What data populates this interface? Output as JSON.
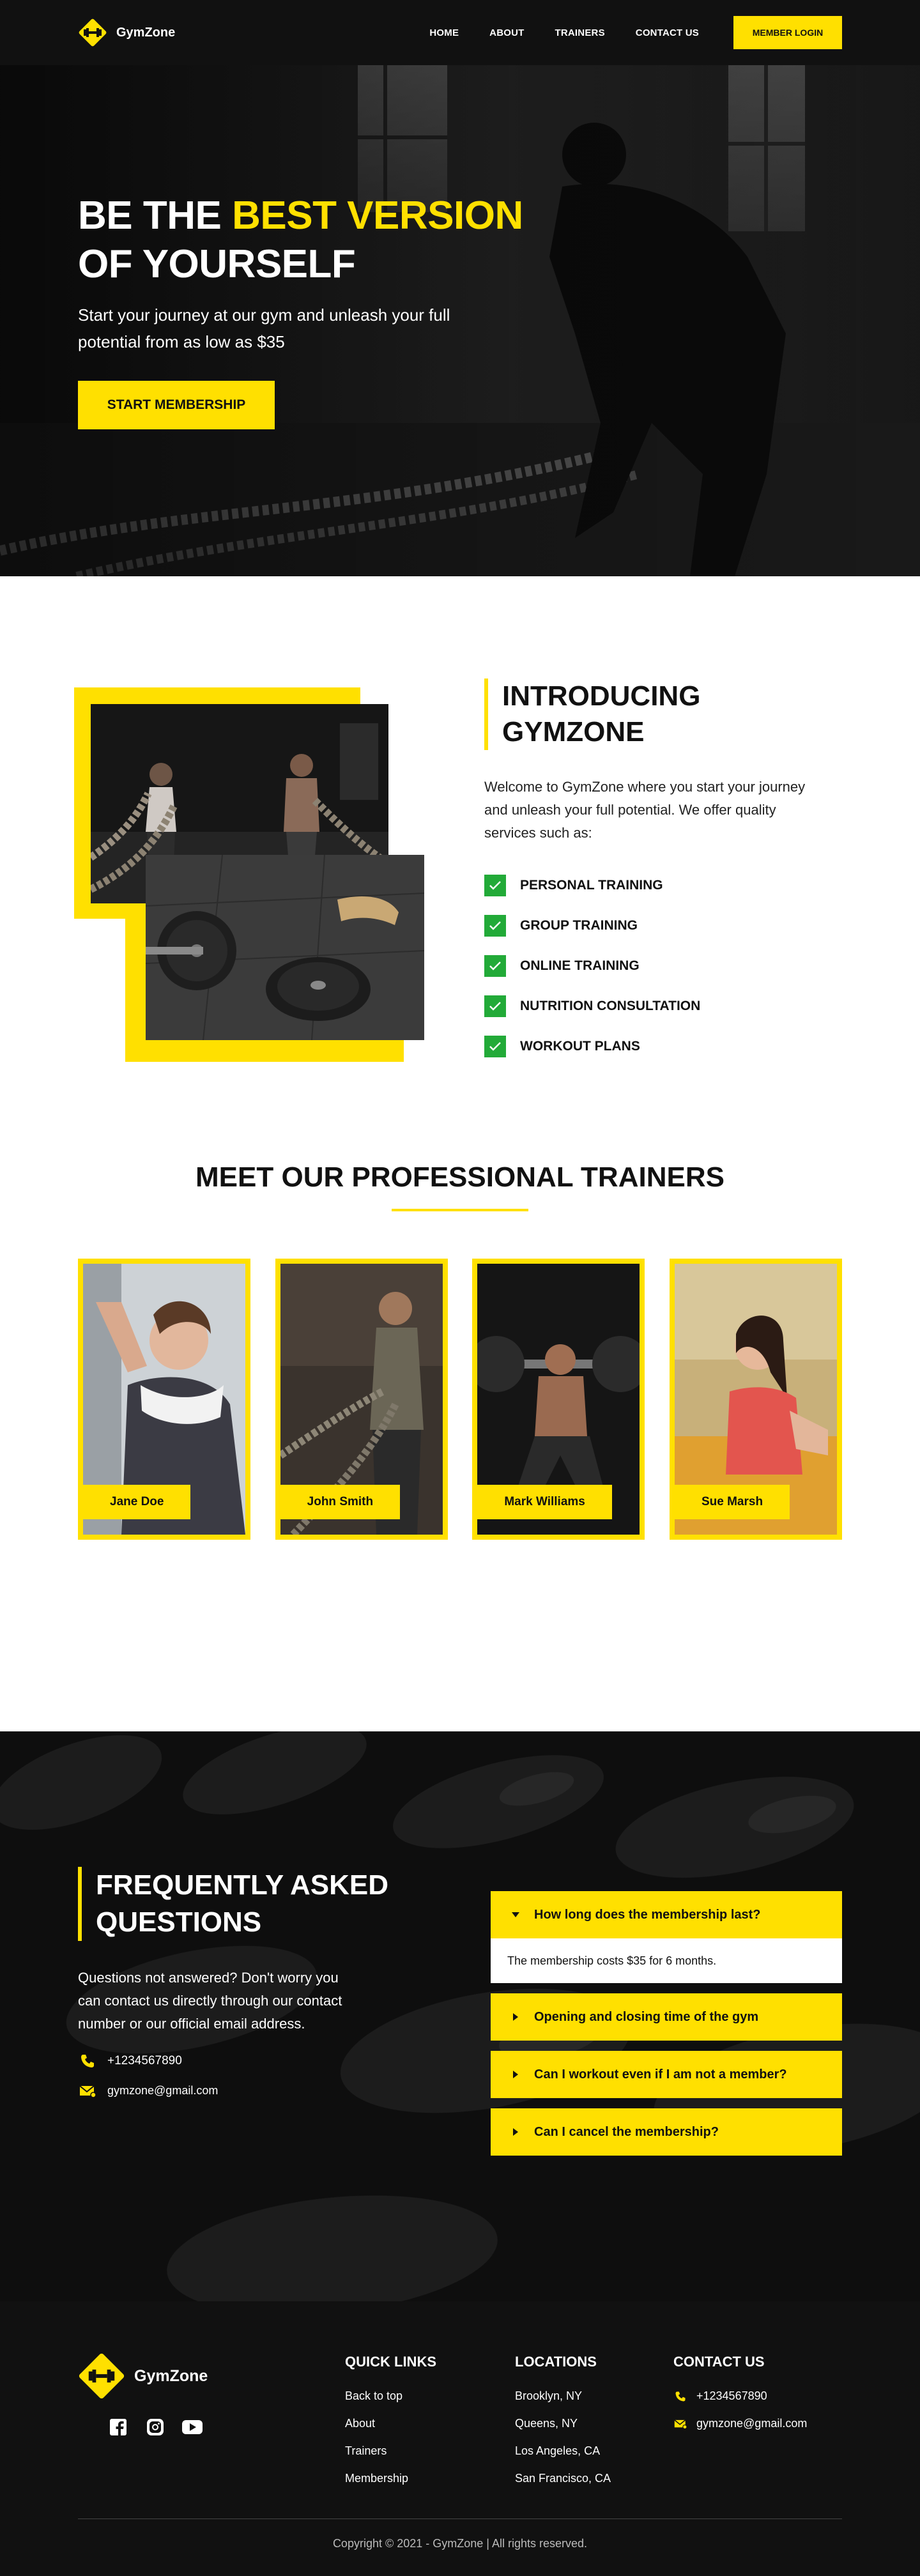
{
  "brand": {
    "name": "GymZone"
  },
  "header": {
    "nav": [
      "HOME",
      "ABOUT",
      "TRAINERS",
      "CONTACT US"
    ],
    "login_label": "MEMBER LOGIN"
  },
  "hero": {
    "title_lead": "BE THE",
    "title_accent": "BEST VERSION",
    "title_line2": "OF YOURSELF",
    "subtitle": "Start your journey at our gym and unleash your full potential from as low as $35",
    "cta_label": "START MEMBERSHIP"
  },
  "intro": {
    "heading": "INTRODUCING GYMZONE",
    "description": "Welcome to GymZone where you start your journey and unleash your full potential. We offer quality services such as:",
    "services": [
      "PERSONAL TRAINING",
      "GROUP TRAINING",
      "ONLINE TRAINING",
      "NUTRITION CONSULTATION",
      "WORKOUT PLANS"
    ]
  },
  "trainers": {
    "heading": "MEET OUR PROFESSIONAL TRAINERS",
    "list": [
      "Jane Doe",
      "John Smith",
      "Mark Williams",
      "Sue Marsh"
    ]
  },
  "faq": {
    "heading": "FREQUENTLY ASKED QUESTIONS",
    "description": "Questions not answered? Don't worry you can contact us directly through our contact number or our official email address.",
    "phone": "+1234567890",
    "email": "gymzone@gmail.com",
    "items": [
      {
        "question": "How long does the membership last?",
        "answer": "The membership costs $35 for 6 months.",
        "open": true
      },
      {
        "question": "Opening and closing time of the gym",
        "open": false
      },
      {
        "question": "Can I workout even if I am not a member?",
        "open": false
      },
      {
        "question": "Can I cancel the membership?",
        "open": false
      }
    ]
  },
  "footer": {
    "brand_name": "GymZone",
    "quick_links_title": "QUICK LINKS",
    "quick_links": [
      "Back to top",
      "About",
      "Trainers",
      "Membership"
    ],
    "locations_title": "LOCATIONS",
    "locations": [
      "Brooklyn, NY",
      "Queens, NY",
      "Los Angeles, CA",
      "San Francisco, CA"
    ],
    "contact_title": "CONTACT US",
    "phone": "+1234567890",
    "email": "gymzone@gmail.com",
    "copyright": "Copyright © 2021 - GymZone | All rights reserved."
  },
  "colors": {
    "accent": "#ffe000",
    "dark": "#111111",
    "check": "#22aa38"
  },
  "icons": [
    "dumbbell-icon",
    "check-icon",
    "phone-icon",
    "mail-icon",
    "caret-down-icon",
    "caret-right-icon",
    "facebook-icon",
    "instagram-icon",
    "youtube-icon"
  ]
}
